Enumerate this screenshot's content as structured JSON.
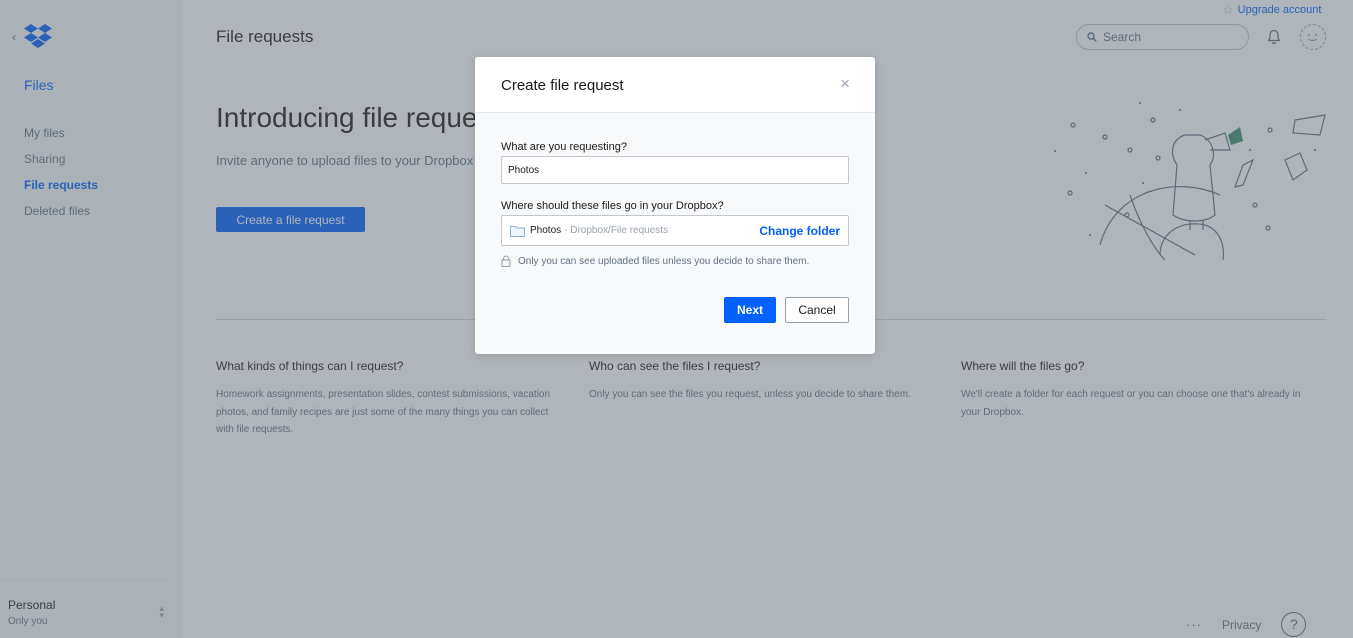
{
  "app": {
    "upgrade_label": "Upgrade account",
    "page_title": "File requests"
  },
  "sidebar": {
    "title": "Files",
    "items": [
      {
        "label": "My files",
        "active": false
      },
      {
        "label": "Sharing",
        "active": false
      },
      {
        "label": "File requests",
        "active": true
      },
      {
        "label": "Deleted files",
        "active": false
      }
    ],
    "account": {
      "name": "Personal",
      "sub": "Only you"
    }
  },
  "header": {
    "search_placeholder": "Search"
  },
  "main": {
    "hero_title": "Introducing file requests",
    "hero_subtitle": "Invite anyone to upload files to your Dropbox",
    "cta_label": "Create a file request",
    "info": [
      {
        "title": "What kinds of things can I request?",
        "body": "Homework assignments, presentation slides, contest submissions, vacation photos, and family recipes are just some of the many things you can collect with file requests."
      },
      {
        "title": "Who can see the files I request?",
        "body": "Only you can see the files you request, unless you decide to share them."
      },
      {
        "title": "Where will the files go?",
        "body": "We'll create a folder for each request or you can choose one that's already in your Dropbox."
      }
    ]
  },
  "footer": {
    "more": "···",
    "privacy": "Privacy",
    "help": "?"
  },
  "modal": {
    "title": "Create file request",
    "close": "×",
    "request_label": "What are you requesting?",
    "request_value": "Photos",
    "dest_label": "Where should these files go in your Dropbox?",
    "folder_name": "Photos",
    "folder_path": "- Dropbox/File requests",
    "change_folder": "Change folder",
    "privacy_note": "Only you can see uploaded files unless you decide to share them.",
    "next_label": "Next",
    "cancel_label": "Cancel"
  },
  "colors": {
    "accent": "#0061fe",
    "overlay": "#58646e"
  }
}
